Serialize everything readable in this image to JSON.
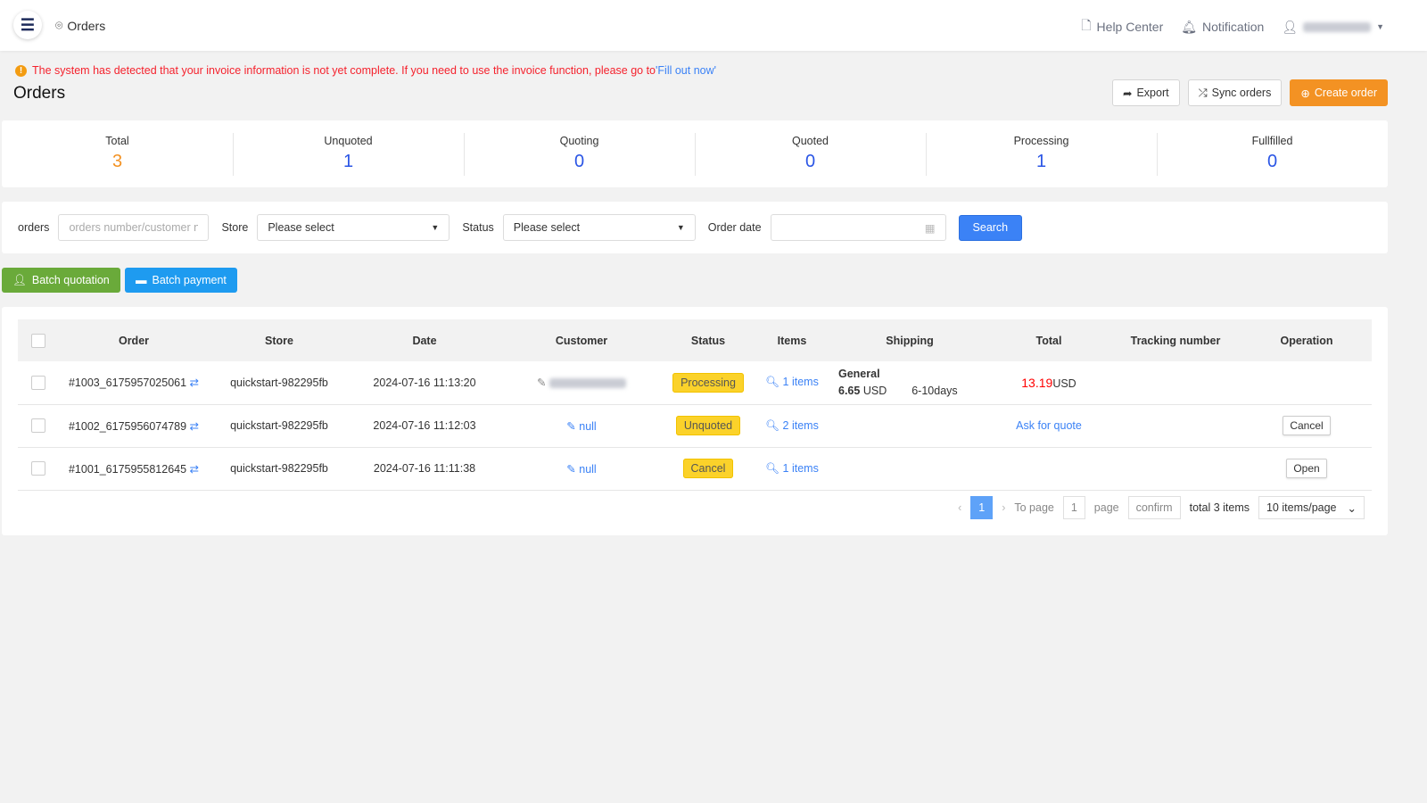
{
  "header": {
    "breadcrumb": "Orders",
    "help": "Help Center",
    "notification": "Notification",
    "icons": [
      "menu-icon",
      "location-pin-icon",
      "document-icon",
      "bell-icon",
      "user-icon",
      "caret-down-icon"
    ]
  },
  "alert": {
    "text": "The system has detected that your invoice information is not yet complete. If you need to use the invoice function, please go to ",
    "link": "'Fill out now'",
    "color": "#f5222d"
  },
  "page": {
    "title": "Orders",
    "export": "Export",
    "sync": "Sync orders",
    "create": "Create order",
    "accent": "#f39223"
  },
  "stats": [
    {
      "label": "Total",
      "value": "3"
    },
    {
      "label": "Unquoted",
      "value": "1"
    },
    {
      "label": "Quoting",
      "value": "0"
    },
    {
      "label": "Quoted",
      "value": "0"
    },
    {
      "label": "Processing",
      "value": "1"
    },
    {
      "label": "Fullfilled",
      "value": "0"
    }
  ],
  "filters": {
    "orders_label": "orders",
    "orders_placeholder": "orders number/customer n",
    "store_label": "Store",
    "store_value": "Please select",
    "status_label": "Status",
    "status_value": "Please select",
    "date_label": "Order date",
    "search": "Search"
  },
  "batch": {
    "quotation": "Batch quotation",
    "payment": "Batch payment"
  },
  "table": {
    "columns": [
      "Order",
      "Store",
      "Date",
      "Customer",
      "Status",
      "Items",
      "Shipping",
      "Total",
      "Tracking number",
      "Operation"
    ],
    "rows": [
      {
        "order": "#1003_6175957025061",
        "store": "quickstart-982295fb",
        "date": "2024-07-16 11:13:20",
        "customer": "",
        "status": "Processing",
        "items": "1 items",
        "ship_name": "General",
        "ship_price": "6.65",
        "ship_cur": "USD",
        "ship_days": "6-10days",
        "total": "13.19",
        "total_cur": "USD",
        "op": ""
      },
      {
        "order": "#1002_6175956074789",
        "store": "quickstart-982295fb",
        "date": "2024-07-16 11:12:03",
        "customer": "null",
        "status": "Unquoted",
        "items": "2 items",
        "total_link": "Ask for quote",
        "op": "Cancel"
      },
      {
        "order": "#1001_6175955812645",
        "store": "quickstart-982295fb",
        "date": "2024-07-16 11:11:38",
        "customer": "null",
        "status": "Cancel",
        "items": "1 items",
        "op": "Open"
      }
    ]
  },
  "pagination": {
    "current": "1",
    "to_page": "To page",
    "page_input": "1",
    "page": "page",
    "confirm": "confirm",
    "total": "total 3 items",
    "per_page": "10 items/page"
  }
}
